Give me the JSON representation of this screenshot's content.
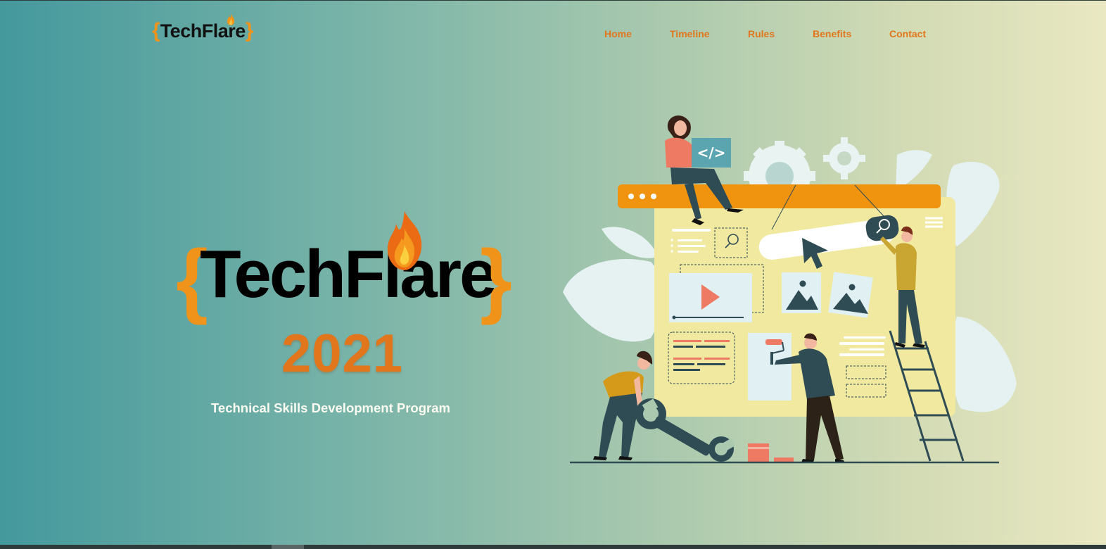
{
  "brand": {
    "brace_open": "{",
    "name": "TechFlare",
    "brace_close": "}"
  },
  "nav": {
    "items": [
      {
        "label": "Home"
      },
      {
        "label": "Timeline"
      },
      {
        "label": "Rules"
      },
      {
        "label": "Benefits"
      },
      {
        "label": "Contact"
      }
    ]
  },
  "hero": {
    "brace_open": "{",
    "title": "TechFlare",
    "brace_close": "}",
    "year": "2021",
    "tagline": "Technical Skills Development Program"
  },
  "illustration": {
    "code_symbol": "</>",
    "icons": [
      "code-icon",
      "gear-icon",
      "search-icon",
      "play-icon",
      "image-icon",
      "menu-icon",
      "cursor-icon",
      "wrench-icon",
      "paint-roller-icon",
      "ladder-icon"
    ]
  },
  "colors": {
    "accent_orange": "#e2761c",
    "brace_orange": "#f0931b",
    "panel_yellow": "#f2e9a0",
    "dark_teal": "#2f4c55"
  }
}
